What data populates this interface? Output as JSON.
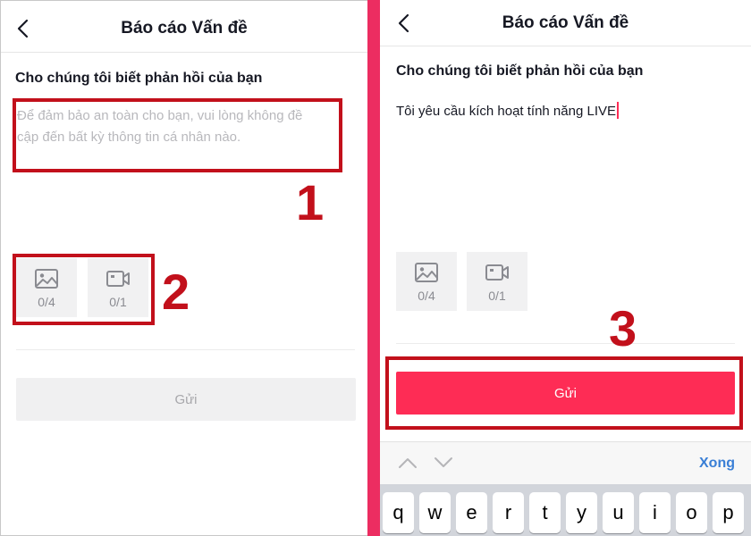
{
  "left": {
    "title": "Báo cáo Vấn đề",
    "feedback_label": "Cho chúng tôi biết phản hồi của bạn",
    "placeholder_line1": "Để đảm bảo an toàn cho bạn, vui lòng không đề",
    "placeholder_line2": "cập đến bất kỳ thông tin cá nhân nào.",
    "photo_count": "0/4",
    "video_count": "0/1",
    "submit_label": "Gửi",
    "annotations": [
      "1",
      "2"
    ]
  },
  "right": {
    "title": "Báo cáo Vấn đề",
    "feedback_label": "Cho chúng tôi biết phản hồi của bạn",
    "typed_text": "Tôi yêu cầu kích hoạt tính năng LIVE",
    "photo_count": "0/4",
    "video_count": "0/1",
    "submit_label": "Gửi",
    "annotation": "3",
    "done_label": "Xong",
    "keys": [
      "q",
      "w",
      "e",
      "r",
      "t",
      "y",
      "u",
      "i",
      "o",
      "p"
    ]
  },
  "icons": {
    "back": "chevron-left-icon",
    "photo": "image-icon",
    "video": "video-camera-icon",
    "up": "chevron-up-icon",
    "down": "chevron-down-icon"
  },
  "colors": {
    "accent": "#fe2c55",
    "divider": "#ec2d61",
    "annotation": "#c2101b",
    "done_link": "#3a7fd6"
  }
}
